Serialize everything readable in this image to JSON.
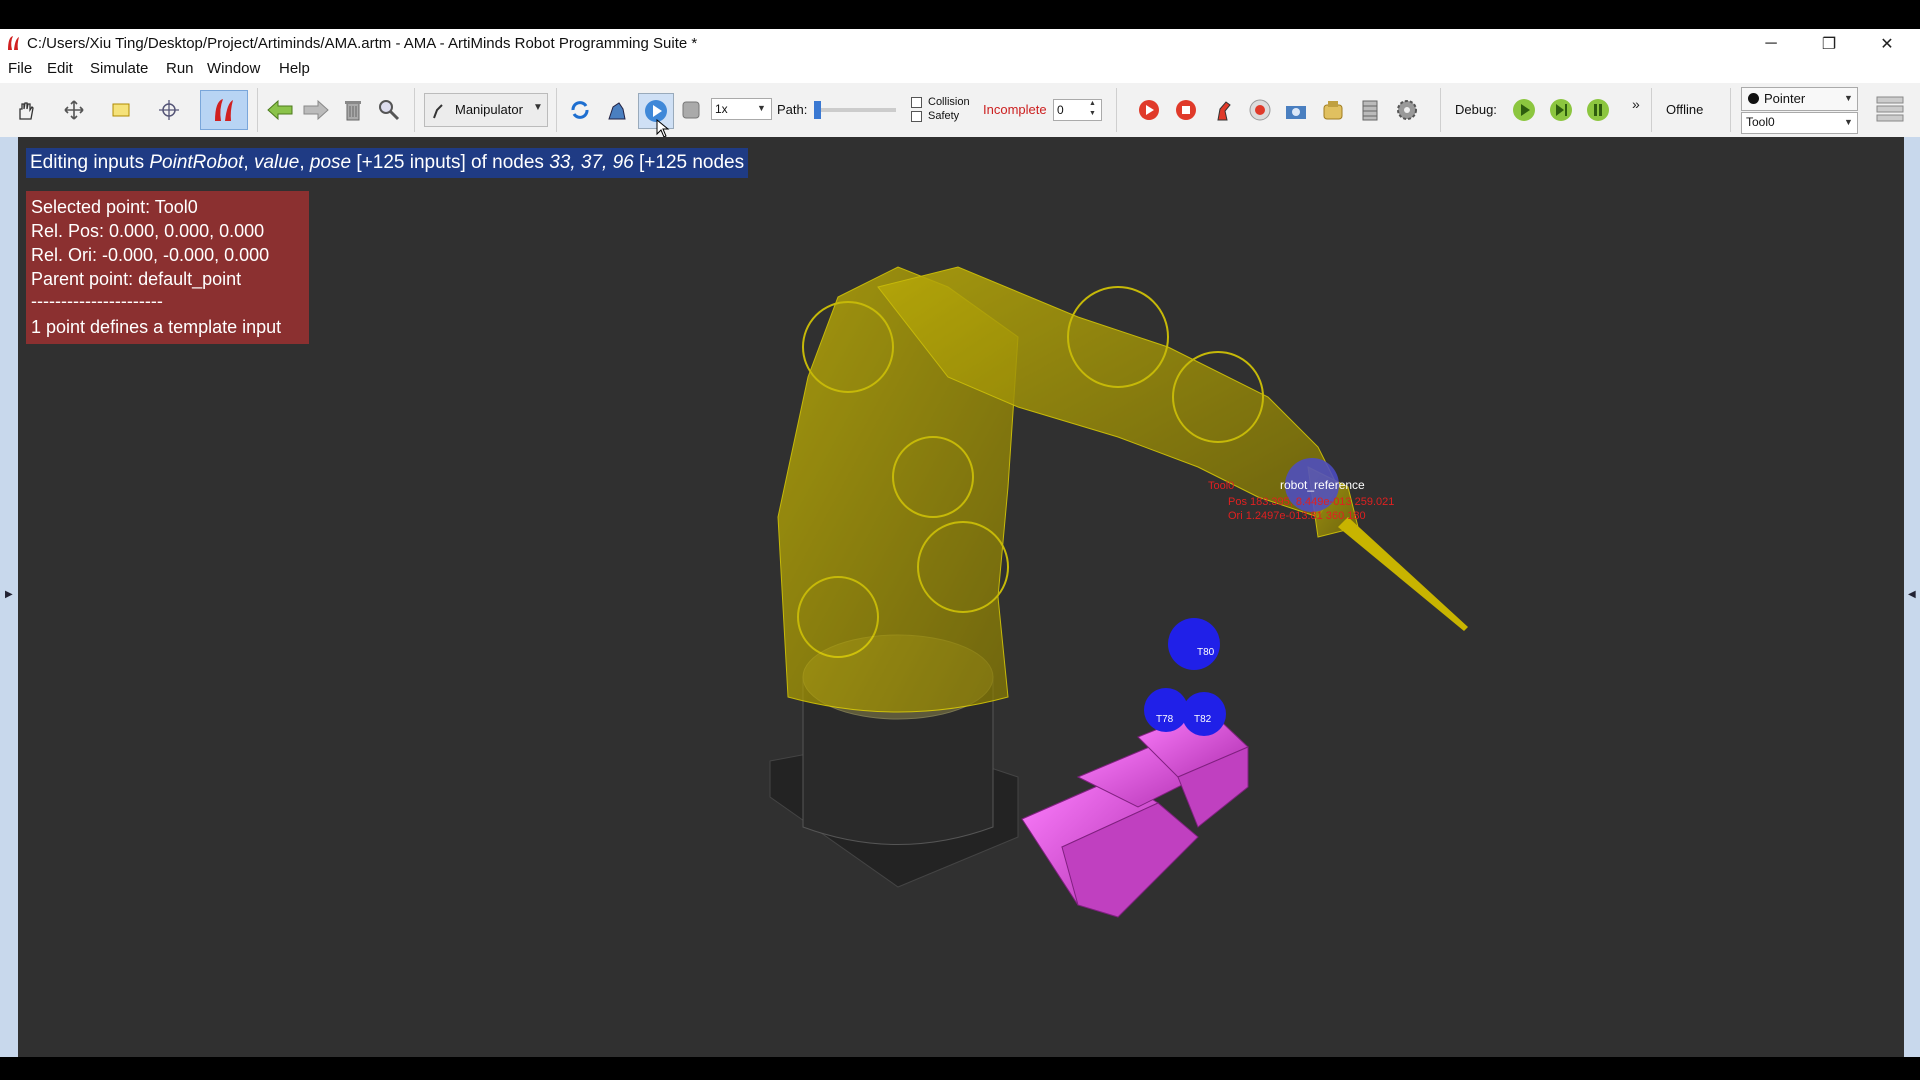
{
  "window": {
    "title": "C:/Users/Xiu Ting/Desktop/Project/Artiminds/AMA.artm - AMA - ArtiMinds Robot Programming Suite *",
    "controls": {
      "minimize": "─",
      "restore": "❐",
      "close": "✕"
    }
  },
  "menu": [
    "File",
    "Edit",
    "Simulate",
    "Run",
    "Window",
    "Help"
  ],
  "toolbar": {
    "manipulator_label": "Manipulator",
    "speed_value": "1x",
    "path_label": "Path:",
    "collision_label": "Collision",
    "safety_label": "Safety",
    "incomplete_label": "Incomplete",
    "incomplete_value": "0",
    "debug_label": "Debug:",
    "more_glyph": "»",
    "offline_label": "Offline",
    "pointer_label": "Pointer",
    "tool_value": "Tool0"
  },
  "viewport": {
    "edit_banner": {
      "prefix": "Editing inputs ",
      "node": "PointRobot",
      "sep1": ", ",
      "input1": "value",
      "sep2": ", ",
      "input2": "pose",
      "middle": " [+125 inputs] of nodes ",
      "ids": "33, 37, 96",
      "suffix": " [+125 nodes"
    },
    "info": {
      "selected": "Selected point: Tool0",
      "rel_pos": "Rel. Pos: 0.000, 0.000, 0.000",
      "rel_ori": "Rel. Ori: -0.000, -0.000, 0.000",
      "parent": "Parent point: default_point",
      "divider": "----------------------",
      "template": "1 point defines a template input"
    },
    "labels": {
      "robot_reference": "robot_reference",
      "tool0": "Tool0",
      "pos_readout": "Pos 183.395, 8.449e-013 259.021",
      "ori_readout": "Ori 1.2497e-013.81 360.180",
      "t80": "T80",
      "t78": "T78",
      "t82": "T82"
    }
  },
  "colors": {
    "viewport_bg": "#303030",
    "robot": "#c8b400",
    "workpiece": "#e060e0",
    "point_blue": "#1f1fe0",
    "banner_bg": "#1f3b84",
    "info_bg": "#8b3030"
  }
}
